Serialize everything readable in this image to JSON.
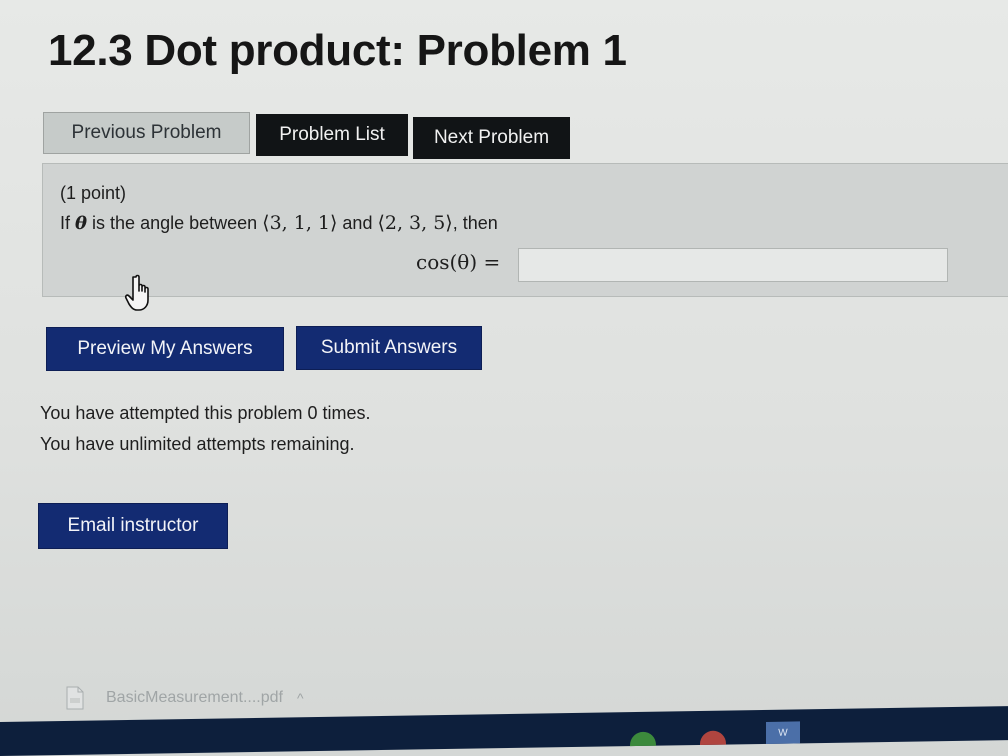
{
  "page": {
    "title": "12.3 Dot product: Problem 1"
  },
  "nav": {
    "previous_label": "Previous Problem",
    "list_label": "Problem List",
    "next_label": "Next Problem"
  },
  "problem": {
    "points": "(1 point)",
    "q_if": "If",
    "q_theta": "θ",
    "q_is_angle": " is the angle between ",
    "vector_a": "⟨3, 1, 1⟩",
    "q_and": " and ",
    "vector_b": "⟨2, 3, 5⟩",
    "q_then": ", then",
    "answer_label": "cos(θ) =",
    "answer_value": ""
  },
  "actions": {
    "preview_label": "Preview My Answers",
    "submit_label": "Submit Answers"
  },
  "attempts": {
    "attempted": "You have attempted this problem 0 times.",
    "remaining": "You have unlimited attempts remaining."
  },
  "contact": {
    "email_label": "Email instructor"
  },
  "download_bar": {
    "filename": "BasicMeasurement....pdf",
    "caret": "^",
    "icon": "pdf-file-icon"
  },
  "taskbar": {
    "word_icon_text": "W"
  },
  "colors": {
    "primary_button": "#132b72",
    "dark_button": "#111416",
    "disabled_button": "#c6cbc9"
  }
}
